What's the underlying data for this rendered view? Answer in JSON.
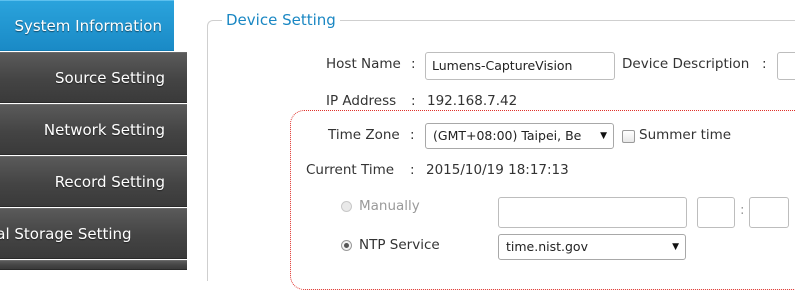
{
  "sidebar": {
    "items": [
      {
        "label": "System Information",
        "active": true
      },
      {
        "label": "Source Setting"
      },
      {
        "label": "Network Setting"
      },
      {
        "label": "Record Setting"
      },
      {
        "label": "cal Storage Setting"
      }
    ]
  },
  "device_setting": {
    "title": "Device Setting",
    "host_name_label": "Host Name",
    "host_name_value": "Lumens-CaptureVision",
    "device_description_label": "Device Description",
    "ip_address_label": "IP Address",
    "ip_address_value": "192.168.7.42",
    "time_zone_label": "Time Zone",
    "time_zone_value": "(GMT+08:00) Taipei, Be",
    "summer_time_label": "Summer time",
    "current_time_label": "Current Time",
    "current_time_value": "2015/10/19 18:17:13",
    "manually_label": "Manually",
    "ntp_service_label": "NTP Service",
    "ntp_server_value": "time.nist.gov",
    "colon": ":",
    "time_separator": ":"
  },
  "colors": {
    "accent": "#1a87c3",
    "active_nav": "#2aa3dc",
    "nav_bg": "#444444",
    "highlight_border": "#e0302a"
  }
}
